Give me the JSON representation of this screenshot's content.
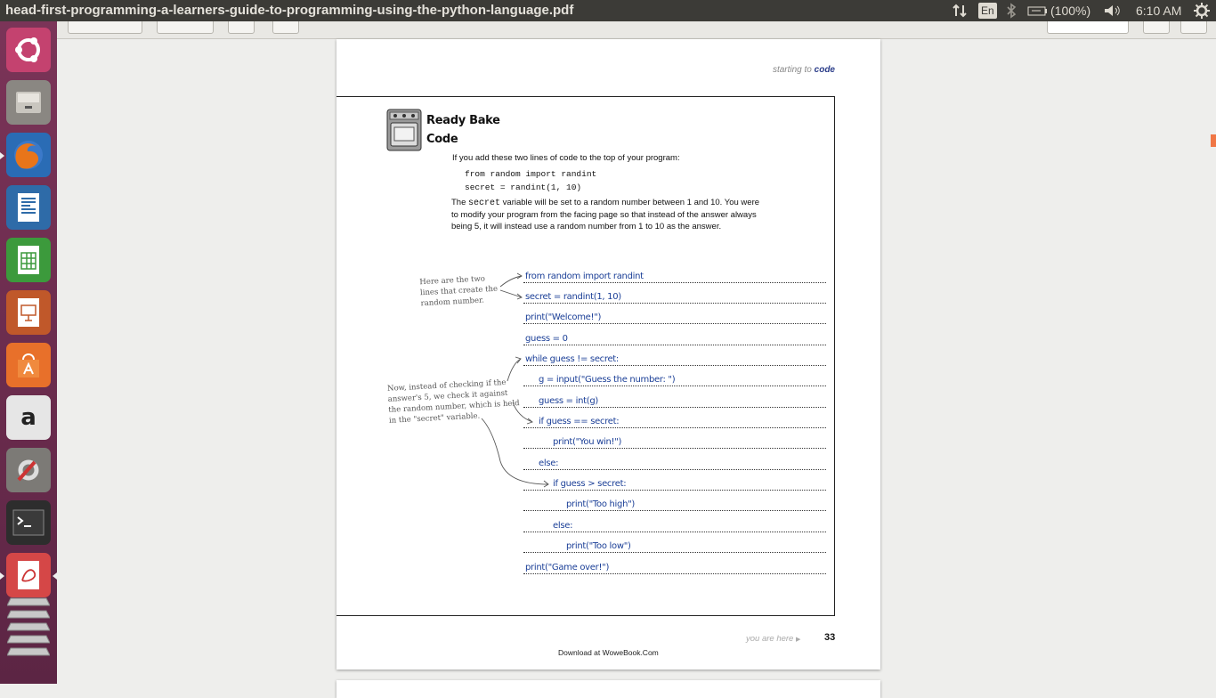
{
  "window": {
    "title": "head-first-programming-a-learners-guide-to-programming-using-the-python-language.pdf"
  },
  "panel": {
    "lang": "En",
    "battery": "(100%)",
    "clock": "6:10 AM"
  },
  "page": {
    "header_prefix": "starting to",
    "header_word": "code",
    "ready_bake_1": "Ready Bake",
    "ready_bake_2": "Code",
    "intro": "If you add these two lines of code to the top of your program:",
    "code1": "from random import randint",
    "code2": "secret = randint(1, 10)",
    "para_pre": "The",
    "para_mono": "secret",
    "para_post": "variable will be set to a random number between 1 and 10. You were to modify your program from the facing page so that instead of the answer always being 5, it will instead use a random number from 1 to 10 as the answer.",
    "note1": [
      "Here are the two",
      "lines that create the",
      "random number."
    ],
    "note2": [
      "Now, instead of checking if the",
      "answer's 5, we check it against",
      "the random number, which is held",
      "in the \"secret\" variable."
    ],
    "program": [
      "from random import randint",
      "secret = randint(1, 10)",
      "print(\"Welcome!\")",
      "guess = 0",
      "while guess != secret:",
      "g = input(\"Guess the number: \")",
      "guess = int(g)",
      "if guess == secret:",
      "print(\"You win!\")",
      "else:",
      "if guess > secret:",
      "print(\"Too high\")",
      "else:",
      "print(\"Too low\")",
      "print(\"Game over!\")"
    ],
    "you_are_here": "you are here",
    "page_number": "33",
    "download": "Download at WoweBook.Com"
  },
  "launcher": {
    "items": [
      "ubuntu-dash",
      "files",
      "firefox",
      "writer",
      "calc",
      "impress",
      "software-center",
      "amazon",
      "system-settings",
      "terminal",
      "document-viewer",
      "workspaces"
    ]
  }
}
